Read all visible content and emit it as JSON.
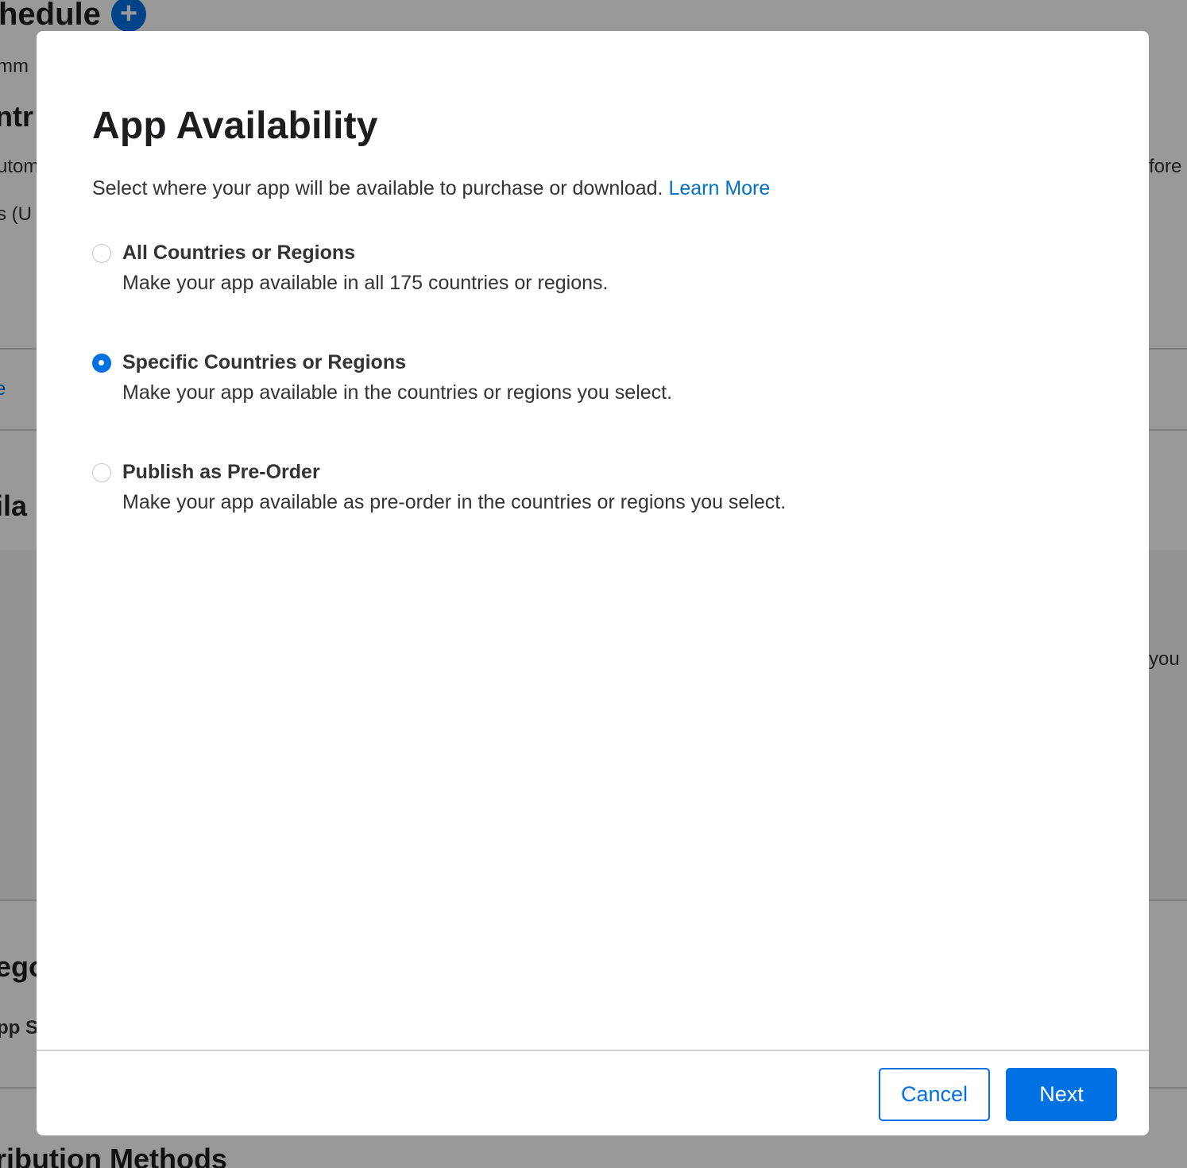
{
  "background": {
    "heading_schedule": "hedule",
    "text_comm": "mm",
    "heading_controls": "ntr",
    "text_autom": "utom",
    "text_before": "fore",
    "text_us": "s (U",
    "link_fragment": "e",
    "heading_availability": "ila",
    "text_you": "e you",
    "heading_category": "ego",
    "text_app_store": "pp S",
    "heading_distribution": "ribution Methods",
    "add_button_glyph": "+"
  },
  "modal": {
    "title": "App Availability",
    "description": "Select where your app will be available to purchase or download.",
    "learn_more": "Learn More",
    "options": [
      {
        "title": "All Countries or Regions",
        "subtitle": "Make your app available in all 175 countries or regions.",
        "selected": false
      },
      {
        "title": "Specific Countries or Regions",
        "subtitle": "Make your app available in the countries or regions you select.",
        "selected": true
      },
      {
        "title": "Publish as Pre-Order",
        "subtitle": "Make your app available as pre-order in the countries or regions you select.",
        "selected": false
      }
    ],
    "buttons": {
      "cancel": "Cancel",
      "next": "Next"
    }
  },
  "colors": {
    "accent": "#0071e3",
    "link": "#0070c9",
    "scrim": "rgba(0,0,0,0.40)"
  }
}
